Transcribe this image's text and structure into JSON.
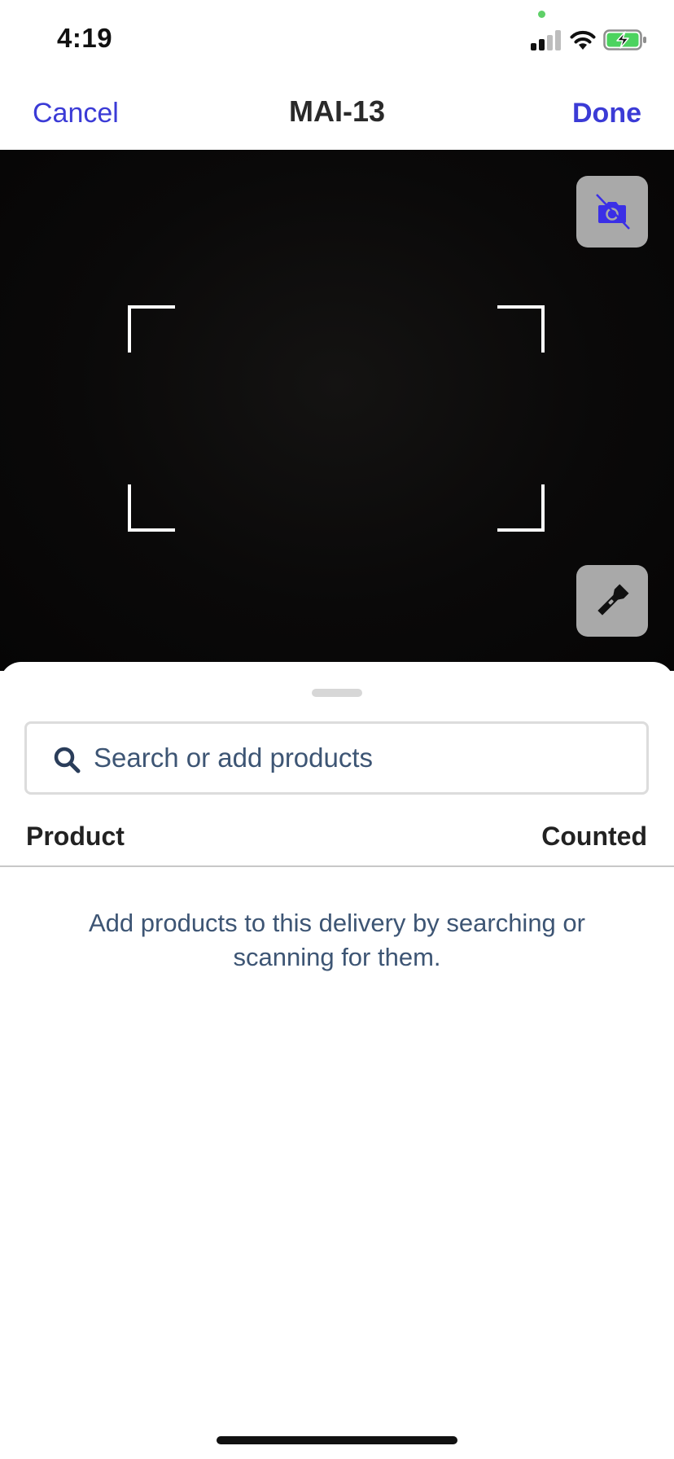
{
  "status_bar": {
    "time": "4:19",
    "signal_icon": "cellular-signal-icon",
    "wifi_icon": "wifi-icon",
    "battery_icon": "battery-charging-icon",
    "mic_indicator_color": "#5fd068"
  },
  "nav": {
    "cancel_label": "Cancel",
    "title": "MAI-13",
    "done_label": "Done",
    "accent_color": "#3b3bd6"
  },
  "camera": {
    "camera_toggle_icon": "camera-off-icon",
    "flashlight_icon": "flashlight-icon"
  },
  "sheet": {
    "search": {
      "placeholder": "Search or add products",
      "value": "",
      "icon": "search-icon"
    },
    "columns": {
      "product": "Product",
      "counted": "Counted"
    },
    "empty_message": "Add products to this delivery by searching or scanning for them."
  }
}
